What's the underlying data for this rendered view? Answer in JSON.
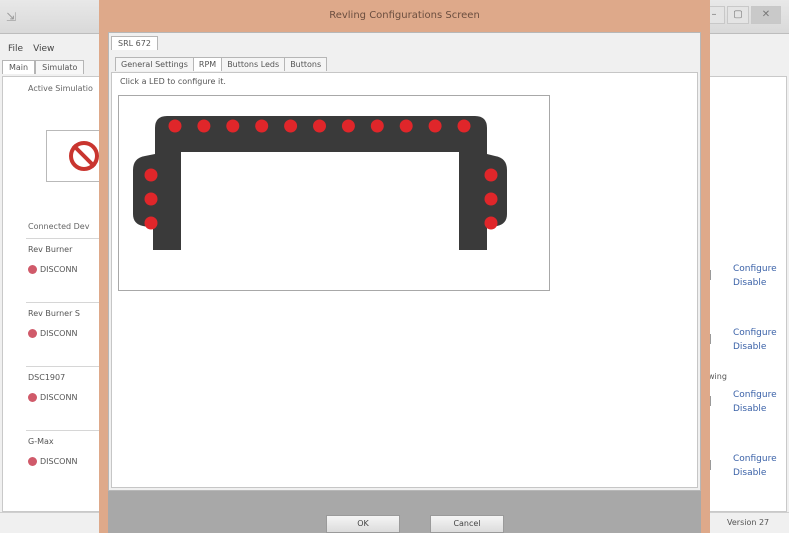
{
  "background_window": {
    "menu": [
      "File",
      "View"
    ],
    "tabs": [
      "Main",
      "Simulato"
    ],
    "active_simulation_label": "Active Simulatio",
    "connected_devices_label": "Connected Dev",
    "devices": [
      {
        "name": "Rev Burner",
        "status": "DISCONN"
      },
      {
        "name": "Rev Burner S",
        "status": "DISCONN"
      },
      {
        "name": "DSC1907",
        "status": "DISCONN"
      },
      {
        "name": "G-Max",
        "status": "DISCONN"
      }
    ],
    "configure_label": "Configure",
    "disable_label": "Disable",
    "side_label": "wing",
    "version_label": "Version 27"
  },
  "dialog": {
    "title": "Revling Configurations Screen",
    "outer_tab": "SRL 672",
    "tabs": [
      "General Settings",
      "RPM",
      "Buttons Leds",
      "Buttons"
    ],
    "active_tab": "RPM",
    "hint": "Click a LED to configure it.",
    "ok_label": "OK",
    "cancel_label": "Cancel",
    "led_color": "#e0262a",
    "frame_color": "#3a3a3a",
    "top_led_count": 11,
    "left_led_count": 3,
    "right_led_count": 3
  }
}
